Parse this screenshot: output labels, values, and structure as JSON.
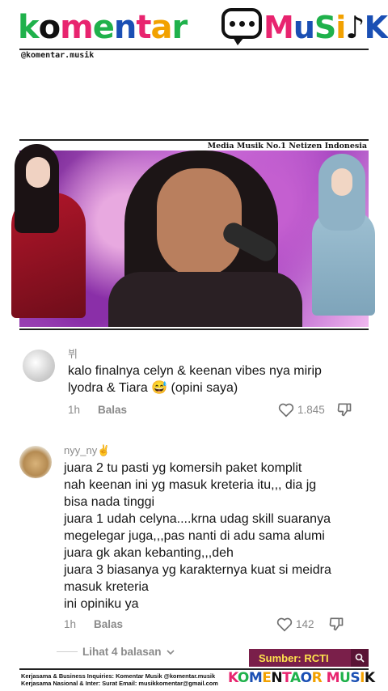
{
  "brand": {
    "logo_letters": [
      {
        "ch": "k",
        "color": "#1fb14b"
      },
      {
        "ch": "o",
        "color": "#111111"
      },
      {
        "ch": "m",
        "color": "#e8246f"
      },
      {
        "ch": "e",
        "color": "#1fb14b"
      },
      {
        "ch": "n",
        "color": "#1a4fb4"
      },
      {
        "ch": "t",
        "color": "#e8246f"
      },
      {
        "ch": "a",
        "color": "#f2a100"
      },
      {
        "ch": "r",
        "color": "#1fb14b"
      }
    ],
    "musik_text": "MuSiK",
    "handle": "@komentar.musik",
    "media_tag": "Media Musik No.1 Netizen Indonesia",
    "source_label": "Sumber: RCTI"
  },
  "comments": [
    {
      "username": "뷔",
      "text": "kalo finalnya celyn & keenan vibes nya mirip\nlyodra & Tiara 😅 (opini saya)",
      "time": "1h",
      "reply_label": "Balas",
      "likes": "1.845"
    },
    {
      "username": "nyy_ny✌",
      "text": "juara 2 tu pasti yg komersih paket komplit\nnah keenan ini yg masuk kreteria itu,,, dia jg\nbisa nada tinggi\njuara 1 udah celyna....krna udag skill suaranya\nmegelegar juga,,,pas nanti di adu sama alumi\njuara gk akan kebanting,,,deh\njuara 3 biasanya yg karakternya kuat si meidra\nmasuk kreteria\nini opiniku ya",
      "time": "1h",
      "reply_label": "Balas",
      "likes": "142",
      "more_replies": "Lihat 4 balasan"
    }
  ],
  "footer": {
    "line1": "Kerjasama & Business Inquiries: Komentar Musik @komentar.musik",
    "line2": "Kerjasama Nasional & Inter: Surat Email: musikkomentar@gmail.com",
    "logo_text": "KOMENTAOR MUSIK"
  }
}
